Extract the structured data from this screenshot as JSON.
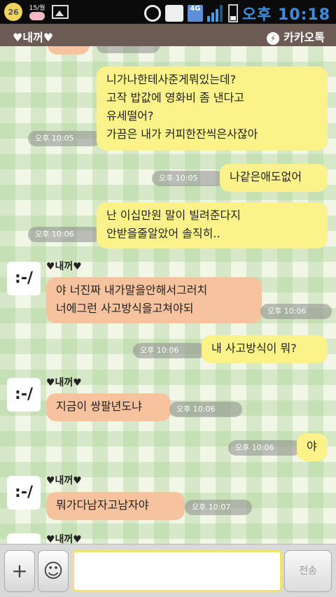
{
  "status": {
    "left_badge": "26",
    "left_cal": "15/월",
    "network": "4G",
    "time": "오후 10:18"
  },
  "title": {
    "name": "♥내꺼♥",
    "brand": "카카오톡"
  },
  "messages": [
    {
      "type": "mine",
      "text": "니가나한테사준게뭐있는데?\n고작 밥값에 영화비 좀 낸다고\n유세떨어?\n가끔은 내가 커피한잔씩은사잖아",
      "time": "오후 10:05"
    },
    {
      "type": "mine",
      "text": "나같은애도없어",
      "time": "오후 10:05"
    },
    {
      "type": "mine",
      "text": "난 이십만원 말이 빌려준다지\n안받을줄알았어 솔직히..",
      "time": "오후 10:06"
    },
    {
      "type": "theirs",
      "sender": "♥내꺼♥",
      "avatar": ":-/",
      "text": "야 너진짜 내가말을안해서그러치\n너에그런 사고방식을고쳐야되",
      "time": "오후 10:06"
    },
    {
      "type": "mine",
      "text": "내 사고방식이 뭐?",
      "time": "오후 10:06"
    },
    {
      "type": "theirs",
      "sender": "♥내꺼♥",
      "avatar": ":-/",
      "text": "지금이 쌍팔년도냐",
      "time": "오후 10:06"
    },
    {
      "type": "mine",
      "text": "야",
      "time": "오후 10:06"
    },
    {
      "type": "theirs",
      "sender": "♥내꺼♥",
      "avatar": ":-/",
      "text": "뭐가다남자고남자야",
      "time": "오후 10:07"
    },
    {
      "type": "theirs-partial",
      "sender": "♥내꺼♥"
    }
  ],
  "input": {
    "plus": "+",
    "emoji": "☺",
    "send": "전송",
    "placeholder": ""
  },
  "colors": {
    "my_bubble": "#fbf38a",
    "their_bubble": "#f6c39e",
    "titlebar": "#6c5a55",
    "input_border": "#f3e36b"
  }
}
